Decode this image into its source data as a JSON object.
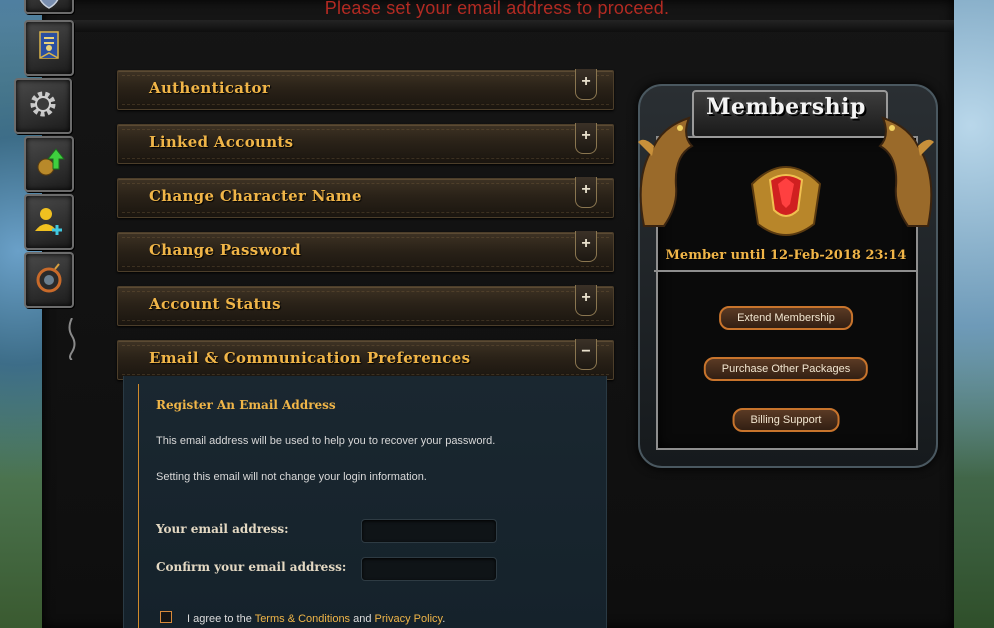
{
  "notice": "Please set your email address to proceed.",
  "dock": {
    "items": [
      {
        "icon": "shield-icon"
      },
      {
        "icon": "banner-icon"
      },
      {
        "icon": "gear-icon"
      },
      {
        "icon": "level-up-icon"
      },
      {
        "icon": "add-friend-icon"
      },
      {
        "icon": "bomb-icon"
      }
    ]
  },
  "accordion": {
    "items": [
      {
        "label": "Authenticator",
        "toggle": "+"
      },
      {
        "label": "Linked Accounts",
        "toggle": "+"
      },
      {
        "label": "Change Character Name",
        "toggle": "+"
      },
      {
        "label": "Change Password",
        "toggle": "+"
      },
      {
        "label": "Account Status",
        "toggle": "+"
      },
      {
        "label": "Email & Communication Preferences",
        "toggle": "−"
      }
    ]
  },
  "email_section": {
    "title": "Register An Email Address",
    "info_1": "This email address will be used to help you to recover your password.",
    "info_2": "Setting this email will not change your login information.",
    "email_label": "Your email address:",
    "email_value": "",
    "confirm_label": "Confirm your email address:",
    "confirm_value": "",
    "agree_prefix": "I agree to the",
    "terms_link": "Terms & Conditions",
    "agree_and": "and",
    "privacy_link": "Privacy Policy",
    "agree_suffix": ".",
    "agree_checked": false
  },
  "membership": {
    "title": "Membership",
    "member_until": "Member until 12-Feb-2018 23:14",
    "buttons": {
      "extend": "Extend Membership",
      "purchase": "Purchase Other Packages",
      "billing": "Billing Support"
    }
  },
  "colors": {
    "accent_gold": "#f0b548",
    "notice_red": "#b22a22",
    "button_border": "#c8742c"
  }
}
